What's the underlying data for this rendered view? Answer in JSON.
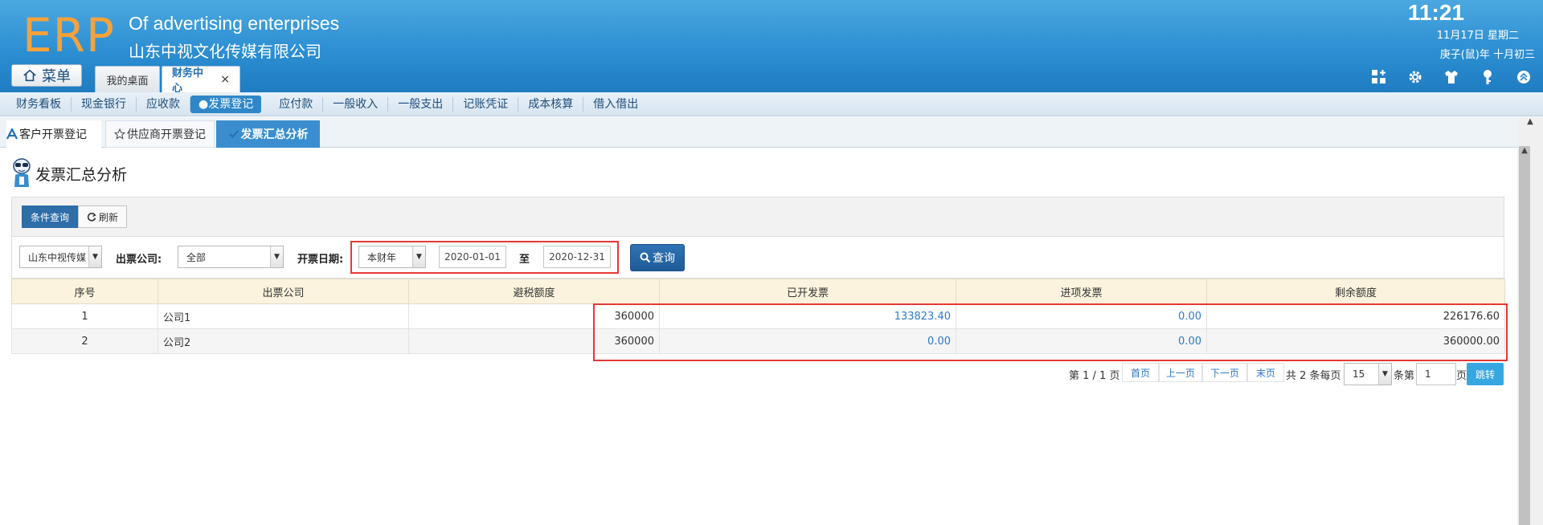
{
  "header": {
    "logo": "ERP",
    "company_en": "Of advertising enterprises",
    "company_cn": "山东中视文化传媒有限公司",
    "time": "11:21",
    "date": "11月17日 星期二",
    "lunar": "庚子(鼠)年 十月初三",
    "menu_label": "菜单",
    "tabs": [
      {
        "label": "我的桌面"
      },
      {
        "label": "财务中心",
        "close": "×"
      }
    ]
  },
  "nav": {
    "items": [
      "财务看板",
      "现金银行",
      "应收款",
      "●发票登记",
      "应付款",
      "一般收入",
      "一般支出",
      "记账凭证",
      "成本核算",
      "借入借出"
    ],
    "active_index": 3
  },
  "subtabs": {
    "customer": "客户开票登记",
    "supplier": "供应商开票登记",
    "summary": "发票汇总分析"
  },
  "page": {
    "title": "发票汇总分析"
  },
  "query": {
    "tab_active": "条件查询",
    "tab_refresh": "刷新",
    "company_select": "山东中视传媒",
    "issuer_label": "出票公司:",
    "issuer_select": "全部",
    "date_label": "开票日期:",
    "period_select": "本财年",
    "date_from": "2020-01-01",
    "date_sep": "至",
    "date_to": "2020-12-31",
    "query_button": "查询"
  },
  "table": {
    "columns": [
      "序号",
      "出票公司",
      "避税额度",
      "已开发票",
      "进项发票",
      "剩余额度"
    ],
    "rows": [
      {
        "no": "1",
        "company": "公司1",
        "quota": "360000",
        "issued": "133823.40",
        "input": "0.00",
        "remain": "226176.60"
      },
      {
        "no": "2",
        "company": "公司2",
        "quota": "360000",
        "issued": "0.00",
        "input": "0.00",
        "remain": "360000.00"
      }
    ]
  },
  "pager": {
    "page_info": "第 1 / 1 页",
    "first": "首页",
    "prev": "上一页",
    "next": "下一页",
    "last": "末页",
    "total": "共 2 条每页",
    "per_page": "15",
    "per_page_suffix": "条第",
    "page_input": "1",
    "page_suffix": "页",
    "jump": "跳转"
  },
  "colors": {
    "header_blue": "#2d8fd2",
    "logo_orange": "#f5a23a",
    "active_blue": "#3a8ed0",
    "link_blue": "#2e79c7",
    "highlight_red": "#e53935",
    "table_header": "#fbf3dd"
  }
}
